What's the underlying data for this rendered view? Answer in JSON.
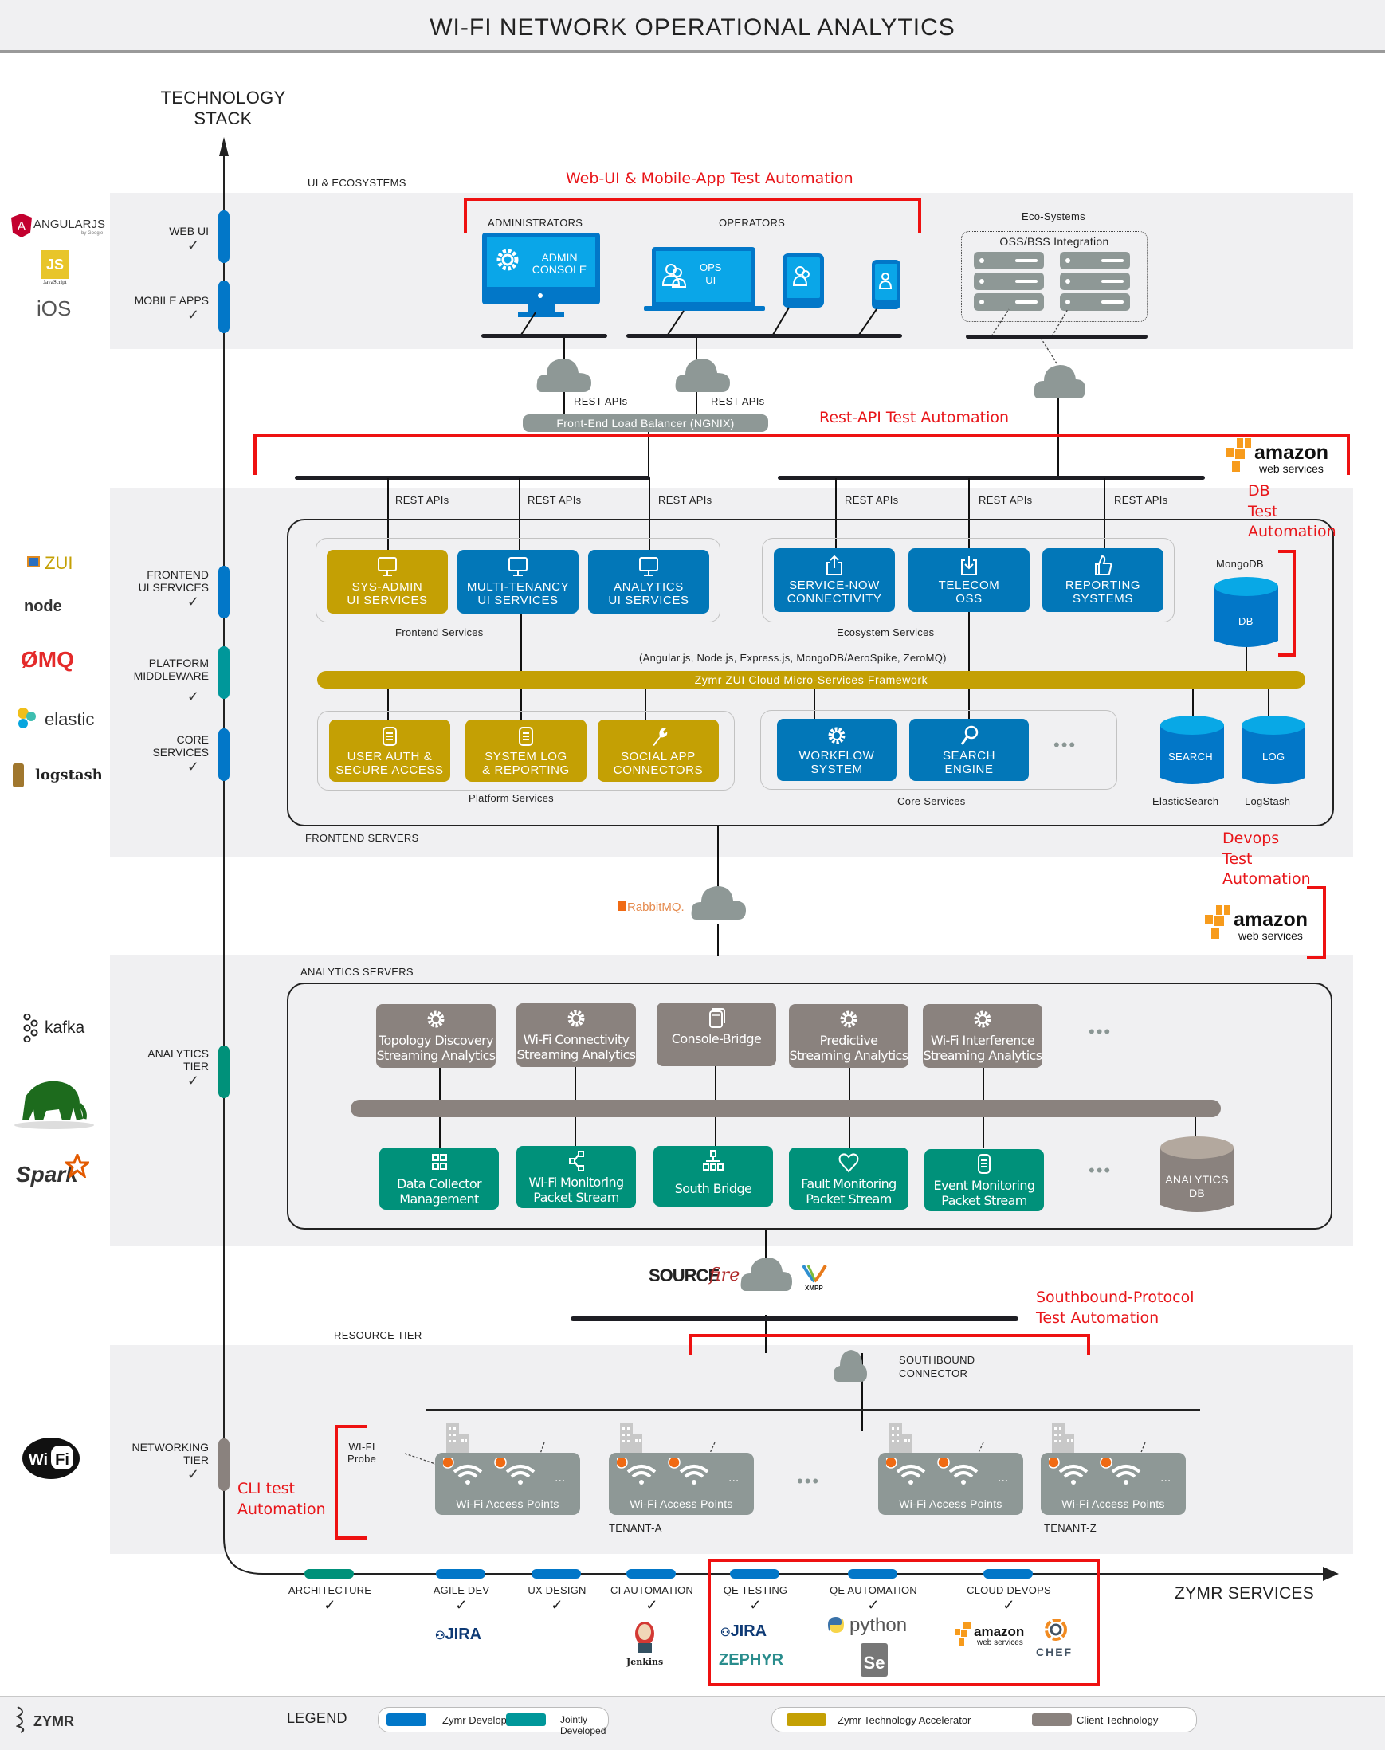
{
  "title": "WI-FI NETWORK OPERATIONAL ANALYTICS",
  "axis": {
    "vertical_label_line1": "TECHNOLOGY",
    "vertical_label_line2": "STACK",
    "horizontal_label": "ZYMR SERVICES"
  },
  "tiers": {
    "web_ui": "WEB UI",
    "mobile_apps": "MOBILE APPS",
    "frontend_ui_line1": "FRONTEND",
    "frontend_ui_line2": "UI SERVICES",
    "platform_line1": "PLATFORM",
    "platform_line2": "MIDDLEWARE",
    "core_line1": "CORE",
    "core_line2": "SERVICES",
    "analytics_line1": "ANALYTICS",
    "analytics_line2": "TIER",
    "networking_line1": "NETWORKING",
    "networking_line2": "TIER",
    "check": "✓"
  },
  "tech_logos": {
    "angular": "ANGULARJS",
    "angular_by": "by Google",
    "js": "JS",
    "js_caption": "JavaScript",
    "ios": "iOS",
    "zui": "ZUI",
    "node": "node",
    "zmq": "ØMQ",
    "elastic": "elastic",
    "logstash": "logstash",
    "kafka": "kafka",
    "spark": "Spark",
    "wifi_wi": "Wi",
    "wifi_fi": "Fi",
    "rabbitmq": "RabbitMQ.",
    "sourcefire_a": "SOURCE",
    "sourcefire_b": "fire",
    "xmpp": "XMPP",
    "aws_main": "amazon",
    "aws_sub": "web services"
  },
  "ui_section": {
    "heading": "UI & ECOSYSTEMS",
    "administrators": "ADMINISTRATORS",
    "admin_console_line1": "ADMIN",
    "admin_console_line2": "CONSOLE",
    "operators": "OPERATORS",
    "ops_ui_line1": "OPS",
    "ops_ui_line2": "UI",
    "eco_systems": "Eco-Systems",
    "oss_bss": "OSS/BSS Integration",
    "rest_apis": "REST APIs",
    "load_balancer": "Front-End Load Balancer (NGNIX)"
  },
  "annotations": {
    "web_ui_test": "Web-UI & Mobile-App Test Automation",
    "rest_api_test": "Rest-API Test Automation",
    "db_test_line1": "DB",
    "db_test_line2": "Test",
    "db_test_line3": "Automation",
    "devops_test_line1": "Devops",
    "devops_test_line2": "Test",
    "devops_test_line3": "Automation",
    "southbound_test_line1": "Southbound-Protocol",
    "southbound_test_line2": "Test Automation",
    "cli_test_line1": "CLI test",
    "cli_test_line2": "Automation"
  },
  "frontend": {
    "rest_apis": [
      "REST APIs",
      "REST APIs",
      "REST APIs",
      "REST APIs",
      "REST APIs",
      "REST APIs"
    ],
    "frontend_services": [
      {
        "line1": "SYS-ADMIN",
        "line2": "UI SERVICES",
        "color": "gold"
      },
      {
        "line1": "MULTI-TENANCY",
        "line2": "UI SERVICES",
        "color": "blue"
      },
      {
        "line1": "ANALYTICS",
        "line2": "UI SERVICES",
        "color": "blue"
      }
    ],
    "frontend_services_label": "Frontend Services",
    "ecosystem_services": [
      {
        "line1": "SERVICE-NOW",
        "line2": "CONNECTIVITY"
      },
      {
        "line1": "TELECOM",
        "line2": "OSS"
      },
      {
        "line1": "REPORTING",
        "line2": "SYSTEMS"
      }
    ],
    "ecosystem_services_label": "Ecosystem Services",
    "mongodb_label": "MongoDB",
    "db": "DB",
    "framework_tech": "(Angular.js, Node.js, Express.js, MongoDB/AeroSpike, ZeroMQ)",
    "framework": "Zymr ZUI Cloud Micro-Services Framework",
    "platform_services": [
      {
        "line1": "USER AUTH &",
        "line2": "SECURE ACCESS"
      },
      {
        "line1": "SYSTEM LOG",
        "line2": "& REPORTING"
      },
      {
        "line1": "SOCIAL APP",
        "line2": "CONNECTORS"
      }
    ],
    "platform_services_label": "Platform Services",
    "core_services": [
      {
        "line1": "WORKFLOW",
        "line2": "SYSTEM"
      },
      {
        "line1": "SEARCH",
        "line2": "ENGINE"
      }
    ],
    "core_services_label": "Core Services",
    "more": "•••",
    "search_db": "SEARCH",
    "log_db": "LOG",
    "elasticsearch_label": "ElasticSearch",
    "logstash_label": "LogStash",
    "servers_label": "FRONTEND SERVERS"
  },
  "analytics": {
    "servers_label": "ANALYTICS SERVERS",
    "top_row": [
      {
        "line1": "Topology Discovery",
        "line2": "Streaming Analytics"
      },
      {
        "line1": "Wi-Fi Connectivity",
        "line2": "Streaming Analytics"
      },
      {
        "line1": "Console-Bridge",
        "line2": ""
      },
      {
        "line1": "Predictive",
        "line2": "Streaming Analytics"
      },
      {
        "line1": "Wi-Fi Interference",
        "line2": "Streaming Analytics"
      }
    ],
    "bottom_row": [
      {
        "line1": "Data Collector",
        "line2": "Management"
      },
      {
        "line1": "Wi-Fi Monitoring",
        "line2": "Packet Stream"
      },
      {
        "line1": "South Bridge",
        "line2": ""
      },
      {
        "line1": "Fault Monitoring",
        "line2": "Packet Stream"
      },
      {
        "line1": "Event Monitoring",
        "line2": "Packet Stream"
      }
    ],
    "more": "•••",
    "db_line1": "ANALYTICS",
    "db_line2": "DB"
  },
  "resource": {
    "tier_label": "RESOURCE TIER",
    "southbound_line1": "SOUTHBOUND",
    "southbound_line2": "CONNECTOR",
    "probe_line1": "WI-FI",
    "probe_line2": "Probe",
    "access_points": [
      "Wi-Fi Access Points",
      "Wi-Fi Access Points",
      "Wi-Fi Access Points",
      "Wi-Fi Access Points"
    ],
    "ap_more": "...",
    "more": "•••",
    "tenant_a": "TENANT-A",
    "tenant_z": "TENANT-Z"
  },
  "services_timeline": [
    {
      "label": "ARCHITECTURE",
      "color": "teal"
    },
    {
      "label": "AGILE DEV",
      "color": "blue"
    },
    {
      "label": "UX DESIGN",
      "color": "blue"
    },
    {
      "label": "CI AUTOMATION",
      "color": "blue"
    },
    {
      "label": "QE TESTING",
      "color": "blue"
    },
    {
      "label": "QE AUTOMATION",
      "color": "blue"
    },
    {
      "label": "CLOUD DEVOPS",
      "color": "blue"
    }
  ],
  "service_tools": {
    "jira": "JIRA",
    "jenkins": "Jenkins",
    "zephyr": "ZEPHYR",
    "python": "python",
    "selenium": "Se",
    "chef": "CHEF",
    "aws_main": "amazon",
    "aws_sub": "web services"
  },
  "footer": {
    "brand": "ZYMR",
    "legend_title": "LEGEND",
    "legend": [
      {
        "label": "Zymr Developed",
        "color": "#0277c8"
      },
      {
        "label": "Jointly Developed",
        "color": "#00979a"
      },
      {
        "label": "Zymr Technology Accelerator",
        "color": "#c4a004"
      },
      {
        "label": "Client Technology",
        "color": "#8a827e"
      }
    ]
  },
  "colors": {
    "zymr_developed": "#0277c8",
    "jointly_developed": "#00979a",
    "accelerator": "#c4a004",
    "client": "#8a827e",
    "annotation_red": "#ee1111"
  }
}
